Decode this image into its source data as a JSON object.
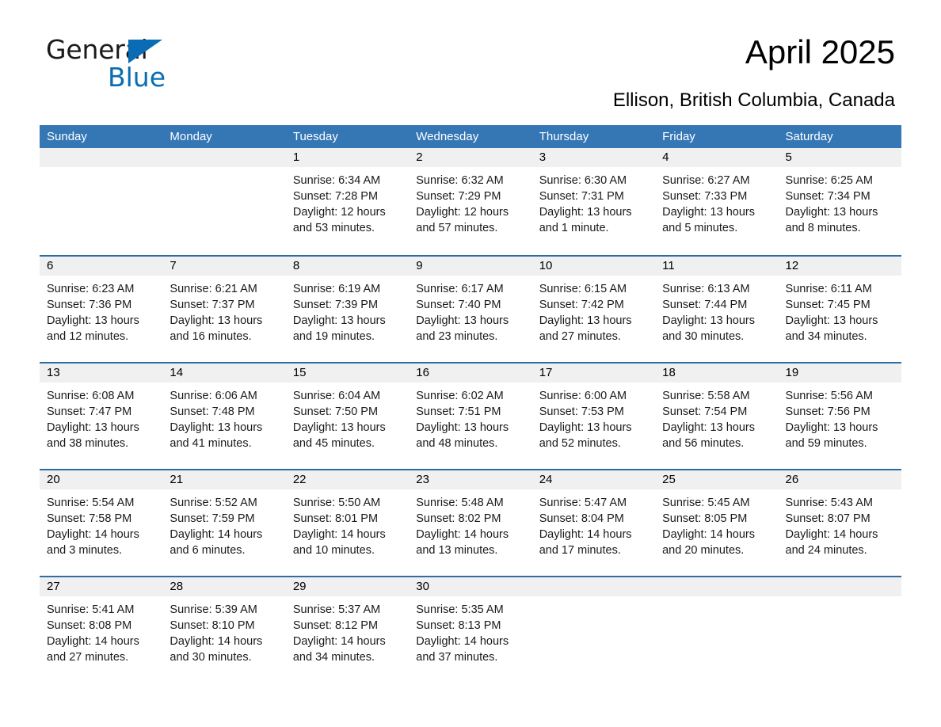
{
  "brand": {
    "word1": "General",
    "word2": "Blue",
    "triangle_color": "#0a6cb4"
  },
  "header": {
    "title": "April 2025",
    "subtitle": "Ellison, British Columbia, Canada"
  },
  "theme": {
    "header_blue": "#3577b5",
    "row_divider_blue": "#2e6ca4",
    "day_band_gray": "#f0f0f0"
  },
  "weekdays": [
    "Sunday",
    "Monday",
    "Tuesday",
    "Wednesday",
    "Thursday",
    "Friday",
    "Saturday"
  ],
  "weeks": [
    [
      {
        "day": "",
        "sunrise": "",
        "sunset": "",
        "daylight": ""
      },
      {
        "day": "",
        "sunrise": "",
        "sunset": "",
        "daylight": ""
      },
      {
        "day": "1",
        "sunrise": "Sunrise: 6:34 AM",
        "sunset": "Sunset: 7:28 PM",
        "daylight": "Daylight: 12 hours and 53 minutes."
      },
      {
        "day": "2",
        "sunrise": "Sunrise: 6:32 AM",
        "sunset": "Sunset: 7:29 PM",
        "daylight": "Daylight: 12 hours and 57 minutes."
      },
      {
        "day": "3",
        "sunrise": "Sunrise: 6:30 AM",
        "sunset": "Sunset: 7:31 PM",
        "daylight": "Daylight: 13 hours and 1 minute."
      },
      {
        "day": "4",
        "sunrise": "Sunrise: 6:27 AM",
        "sunset": "Sunset: 7:33 PM",
        "daylight": "Daylight: 13 hours and 5 minutes."
      },
      {
        "day": "5",
        "sunrise": "Sunrise: 6:25 AM",
        "sunset": "Sunset: 7:34 PM",
        "daylight": "Daylight: 13 hours and 8 minutes."
      }
    ],
    [
      {
        "day": "6",
        "sunrise": "Sunrise: 6:23 AM",
        "sunset": "Sunset: 7:36 PM",
        "daylight": "Daylight: 13 hours and 12 minutes."
      },
      {
        "day": "7",
        "sunrise": "Sunrise: 6:21 AM",
        "sunset": "Sunset: 7:37 PM",
        "daylight": "Daylight: 13 hours and 16 minutes."
      },
      {
        "day": "8",
        "sunrise": "Sunrise: 6:19 AM",
        "sunset": "Sunset: 7:39 PM",
        "daylight": "Daylight: 13 hours and 19 minutes."
      },
      {
        "day": "9",
        "sunrise": "Sunrise: 6:17 AM",
        "sunset": "Sunset: 7:40 PM",
        "daylight": "Daylight: 13 hours and 23 minutes."
      },
      {
        "day": "10",
        "sunrise": "Sunrise: 6:15 AM",
        "sunset": "Sunset: 7:42 PM",
        "daylight": "Daylight: 13 hours and 27 minutes."
      },
      {
        "day": "11",
        "sunrise": "Sunrise: 6:13 AM",
        "sunset": "Sunset: 7:44 PM",
        "daylight": "Daylight: 13 hours and 30 minutes."
      },
      {
        "day": "12",
        "sunrise": "Sunrise: 6:11 AM",
        "sunset": "Sunset: 7:45 PM",
        "daylight": "Daylight: 13 hours and 34 minutes."
      }
    ],
    [
      {
        "day": "13",
        "sunrise": "Sunrise: 6:08 AM",
        "sunset": "Sunset: 7:47 PM",
        "daylight": "Daylight: 13 hours and 38 minutes."
      },
      {
        "day": "14",
        "sunrise": "Sunrise: 6:06 AM",
        "sunset": "Sunset: 7:48 PM",
        "daylight": "Daylight: 13 hours and 41 minutes."
      },
      {
        "day": "15",
        "sunrise": "Sunrise: 6:04 AM",
        "sunset": "Sunset: 7:50 PM",
        "daylight": "Daylight: 13 hours and 45 minutes."
      },
      {
        "day": "16",
        "sunrise": "Sunrise: 6:02 AM",
        "sunset": "Sunset: 7:51 PM",
        "daylight": "Daylight: 13 hours and 48 minutes."
      },
      {
        "day": "17",
        "sunrise": "Sunrise: 6:00 AM",
        "sunset": "Sunset: 7:53 PM",
        "daylight": "Daylight: 13 hours and 52 minutes."
      },
      {
        "day": "18",
        "sunrise": "Sunrise: 5:58 AM",
        "sunset": "Sunset: 7:54 PM",
        "daylight": "Daylight: 13 hours and 56 minutes."
      },
      {
        "day": "19",
        "sunrise": "Sunrise: 5:56 AM",
        "sunset": "Sunset: 7:56 PM",
        "daylight": "Daylight: 13 hours and 59 minutes."
      }
    ],
    [
      {
        "day": "20",
        "sunrise": "Sunrise: 5:54 AM",
        "sunset": "Sunset: 7:58 PM",
        "daylight": "Daylight: 14 hours and 3 minutes."
      },
      {
        "day": "21",
        "sunrise": "Sunrise: 5:52 AM",
        "sunset": "Sunset: 7:59 PM",
        "daylight": "Daylight: 14 hours and 6 minutes."
      },
      {
        "day": "22",
        "sunrise": "Sunrise: 5:50 AM",
        "sunset": "Sunset: 8:01 PM",
        "daylight": "Daylight: 14 hours and 10 minutes."
      },
      {
        "day": "23",
        "sunrise": "Sunrise: 5:48 AM",
        "sunset": "Sunset: 8:02 PM",
        "daylight": "Daylight: 14 hours and 13 minutes."
      },
      {
        "day": "24",
        "sunrise": "Sunrise: 5:47 AM",
        "sunset": "Sunset: 8:04 PM",
        "daylight": "Daylight: 14 hours and 17 minutes."
      },
      {
        "day": "25",
        "sunrise": "Sunrise: 5:45 AM",
        "sunset": "Sunset: 8:05 PM",
        "daylight": "Daylight: 14 hours and 20 minutes."
      },
      {
        "day": "26",
        "sunrise": "Sunrise: 5:43 AM",
        "sunset": "Sunset: 8:07 PM",
        "daylight": "Daylight: 14 hours and 24 minutes."
      }
    ],
    [
      {
        "day": "27",
        "sunrise": "Sunrise: 5:41 AM",
        "sunset": "Sunset: 8:08 PM",
        "daylight": "Daylight: 14 hours and 27 minutes."
      },
      {
        "day": "28",
        "sunrise": "Sunrise: 5:39 AM",
        "sunset": "Sunset: 8:10 PM",
        "daylight": "Daylight: 14 hours and 30 minutes."
      },
      {
        "day": "29",
        "sunrise": "Sunrise: 5:37 AM",
        "sunset": "Sunset: 8:12 PM",
        "daylight": "Daylight: 14 hours and 34 minutes."
      },
      {
        "day": "30",
        "sunrise": "Sunrise: 5:35 AM",
        "sunset": "Sunset: 8:13 PM",
        "daylight": "Daylight: 14 hours and 37 minutes."
      },
      {
        "day": "",
        "sunrise": "",
        "sunset": "",
        "daylight": ""
      },
      {
        "day": "",
        "sunrise": "",
        "sunset": "",
        "daylight": ""
      },
      {
        "day": "",
        "sunrise": "",
        "sunset": "",
        "daylight": ""
      }
    ]
  ]
}
